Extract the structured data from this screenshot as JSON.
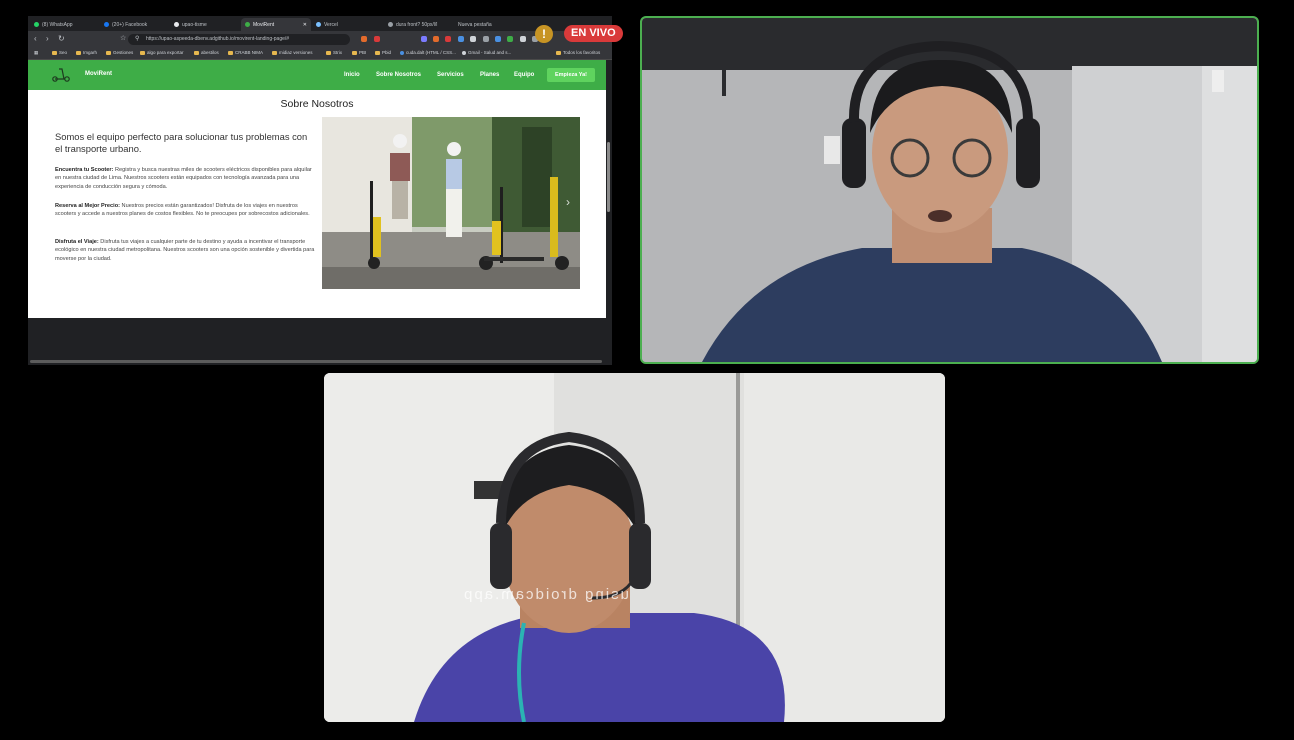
{
  "browser": {
    "tabs": [
      {
        "label": "(8) WhatsApp",
        "color": "#25d366"
      },
      {
        "label": "(20+) Facebook",
        "color": "#1877f2"
      },
      {
        "label": "upao-tisme",
        "color": "#e8eaed"
      },
      {
        "label": "MoviRent",
        "color": "#3ead47"
      },
      {
        "label": "Vercel",
        "color": "#7ac0ff"
      },
      {
        "label": "dura front? 50px/l/l",
        "color": "#9aa0a6"
      },
      {
        "label": "Nueva pestaña",
        "color": "#9aa0a6"
      }
    ],
    "url": "https://upao-aspeeda-dbenv.adgithub.io/movirent-landing-page/#",
    "bookmarks": [
      "Seo",
      "Imgarh",
      "Gestiones",
      "algo para exportar",
      "abestilos",
      "CRABB NIMA",
      "midiaz versiones",
      "Strix",
      "PBI",
      "Pbid",
      "cuda.dalt (HTML / CSS...",
      "Gmail - Salud and s...",
      "Todos los favoritos"
    ]
  },
  "website": {
    "brand": "MoviRent",
    "accent": "#3ead47",
    "nav": [
      "Inicio",
      "Sobre Nosotros",
      "Servicios",
      "Planes",
      "Equipo"
    ],
    "cta": "Empieza Ya!",
    "section_title": "Sobre Nosotros",
    "intro": "Somos el equipo perfecto para solucionar tus problemas con el transporte urbano.",
    "features": [
      {
        "title": "Encuentra tu Scooter:",
        "text": " Registra y busca nuestras miles de scooters eléctricos disponibles para alquilar en nuestra ciudad de Lima. Nuestros scooters están equipados con tecnología avanzada para una experiencia de conducción segura y cómoda."
      },
      {
        "title": "Reserva al Mejor Precio:",
        "text": " Nuestros precios están garantizados! Disfruta de los viajes en nuestros scooters y accede a nuestros planes de costos flexibles. No te preocupes por sobrecostos adicionales."
      },
      {
        "title": "Disfruta el Viaje:",
        "text": " Disfruta tus viajes a cualquier parte de tu destino y ayuda a incentivar el transporte ecológico en nuestra ciudad metropolitana. Nuestros scooters son una opción sostenible y divertida para moverse por la ciudad."
      }
    ],
    "carousel_next": "›"
  },
  "stream": {
    "live_label": "EN VIVO",
    "alert_glyph": "!",
    "watermark": "using droidcam.app"
  }
}
